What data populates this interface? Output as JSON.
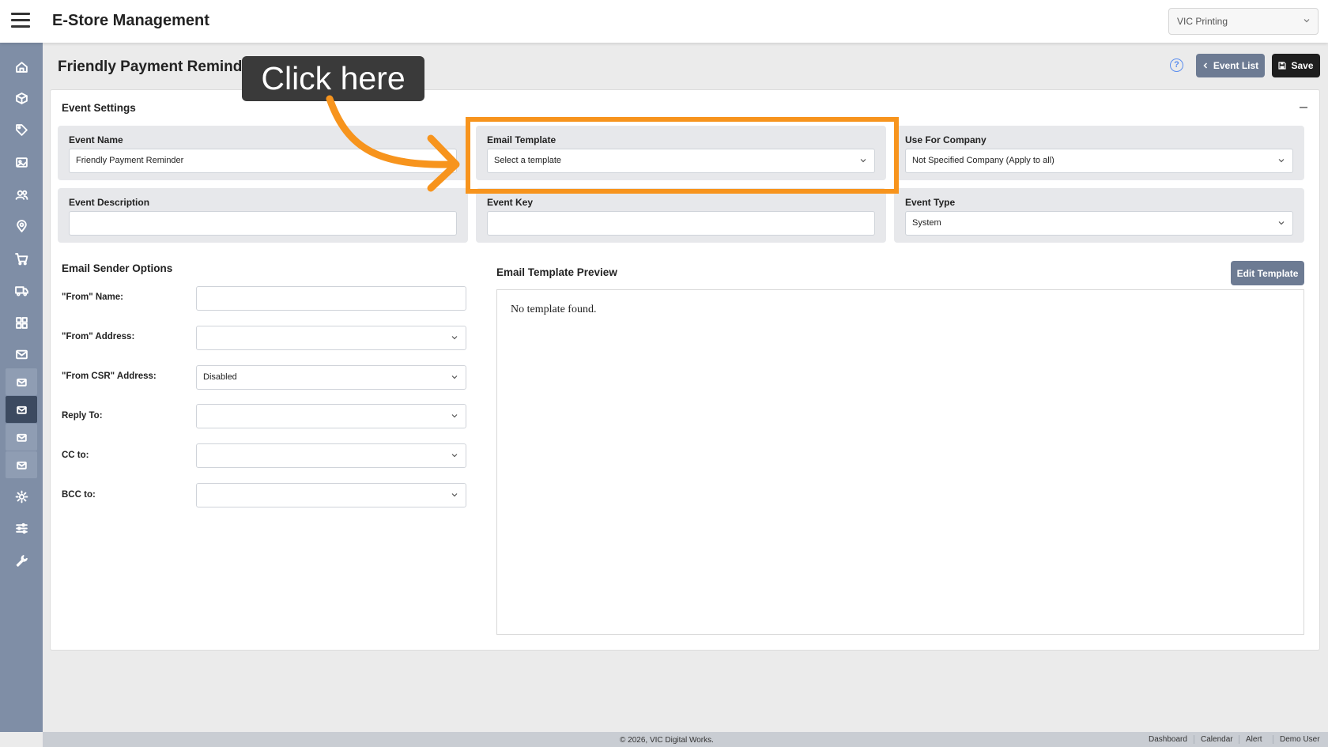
{
  "app": {
    "title": "E-Store Management"
  },
  "header": {
    "company_select": "VIC Printing"
  },
  "page": {
    "title": "Friendly Payment Reminder",
    "event_list_label": "Event List",
    "save_label": "Save"
  },
  "event_settings": {
    "title": "Event Settings",
    "event_name": {
      "label": "Event Name",
      "value": "Friendly Payment Reminder"
    },
    "email_template": {
      "label": "Email Template",
      "value": "Select a template"
    },
    "use_for_company": {
      "label": "Use For Company",
      "value": "Not Specified Company (Apply to all)"
    },
    "event_description": {
      "label": "Event Description",
      "value": ""
    },
    "event_key": {
      "label": "Event Key",
      "value": ""
    },
    "event_type": {
      "label": "Event Type",
      "value": "System"
    }
  },
  "sender_options": {
    "title": "Email Sender Options",
    "from_name": {
      "label": "\"From\" Name:",
      "value": ""
    },
    "from_address": {
      "label": "\"From\" Address:",
      "value": ""
    },
    "from_csr": {
      "label": "\"From CSR\" Address:",
      "value": "Disabled"
    },
    "reply_to": {
      "label": "Reply To:",
      "value": ""
    },
    "cc_to": {
      "label": "CC to:",
      "value": ""
    },
    "bcc_to": {
      "label": "BCC to:",
      "value": ""
    }
  },
  "preview": {
    "title": "Email Template Preview",
    "edit_label": "Edit Template",
    "empty_text": "No template found."
  },
  "footer": {
    "copyright": "© 2026, VIC Digital Works.",
    "links": [
      "Dashboard",
      "Calendar",
      "Alert",
      "Demo User"
    ]
  },
  "annotation": {
    "callout_text": "Click here",
    "accent_color": "#f7941d"
  },
  "sidebar": {
    "icons": [
      "home-icon",
      "package-icon",
      "tag-icon",
      "image-icon",
      "users-icon",
      "location-pin-icon",
      "cart-icon",
      "truck-icon",
      "grid-icon",
      "mail-icon",
      "mail-sub-icon",
      "mail-sub-active-icon",
      "mail-sub-icon",
      "mail-sub-icon",
      "gear-icon",
      "sliders-icon",
      "wrench-icon"
    ]
  }
}
